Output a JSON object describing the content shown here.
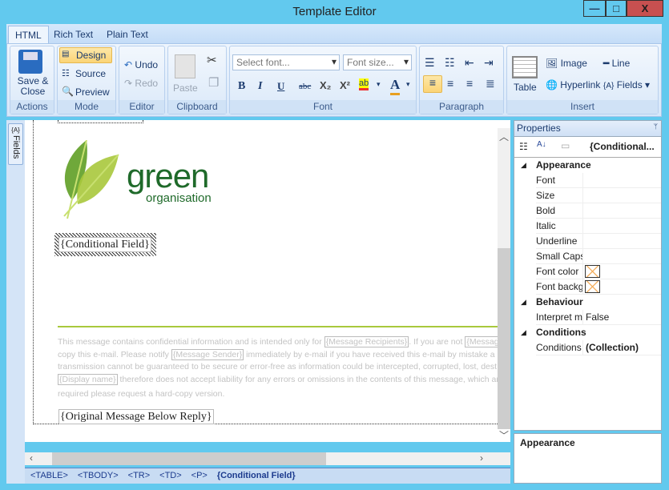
{
  "window": {
    "title": "Template Editor",
    "minimize": "—",
    "maximize": "□",
    "close": "X"
  },
  "tabs": [
    {
      "label": "HTML",
      "active": true
    },
    {
      "label": "Rich Text"
    },
    {
      "label": "Plain Text"
    }
  ],
  "ribbon": {
    "actions": {
      "label": "Actions",
      "save": "Save & Close"
    },
    "mode": {
      "label": "Mode",
      "design": "Design",
      "source": "Source",
      "preview": "Preview",
      "selected": "Design"
    },
    "editor": {
      "label": "Editor",
      "undo": "Undo",
      "redo": "Redo"
    },
    "clipboard": {
      "label": "Clipboard",
      "paste": "Paste"
    },
    "font": {
      "label": "Font",
      "font_placeholder": "Select font...",
      "size_placeholder": "Font size...",
      "bold": "B",
      "italic": "I",
      "underline": "U",
      "strike": "abc",
      "sub": "X₂",
      "sup": "X²",
      "highlight": "ab",
      "color": "A"
    },
    "paragraph": {
      "label": "Paragraph",
      "alignment": "left"
    },
    "insert": {
      "label": "Insert",
      "table": "Table",
      "image": "Image",
      "line": "Line",
      "hyperlink": "Hyperlink",
      "fields": "Fields"
    }
  },
  "side_tab": {
    "label": "Fields",
    "icon": "{A}"
  },
  "document": {
    "logo": {
      "big": "green",
      "small": "organisation"
    },
    "conditional_field": "{Conditional Field}",
    "disclaimer": [
      [
        "This message contains confidential information and is intended only for ",
        "{Message Recipients}",
        ". If you are not ",
        "{Messag"
      ],
      [
        "copy this e-mail. Please notify ",
        "{Message Sender}",
        " immediately by e-mail if you have received this e-mail by mistake a"
      ],
      [
        "transmission cannot be guaranteed to be secure or error-free as information could be intercepted, corrupted, lost, dest"
      ],
      [
        "{Display name}",
        " therefore does not accept liability for any errors or omissions in the contents of this message, which ari"
      ]
    ],
    "disclaimer_end": "required please request a hard-copy version.",
    "original_message": "{Original Message Below Reply}",
    "accent": "#a8c83c"
  },
  "breadcrumb": [
    "<TABLE>",
    "<TBODY>",
    "<TR>",
    "<TD>",
    "<P>",
    "{Conditional Field}"
  ],
  "properties": {
    "title": "Properties",
    "pin": "📌",
    "object": "{Conditional...",
    "categories": [
      {
        "name": "Appearance",
        "rows": [
          {
            "name": "Font",
            "value": ""
          },
          {
            "name": "Size",
            "value": ""
          },
          {
            "name": "Bold",
            "value": ""
          },
          {
            "name": "Italic",
            "value": ""
          },
          {
            "name": "Underline",
            "value": ""
          },
          {
            "name": "Small Caps",
            "value": ""
          },
          {
            "name": "Font color",
            "value": "",
            "swatch": true
          },
          {
            "name": "Font backg",
            "value": "",
            "swatch": true
          }
        ]
      },
      {
        "name": "Behaviour",
        "rows": [
          {
            "name": "Interpret m",
            "value": "False"
          }
        ]
      },
      {
        "name": "Conditions",
        "rows": [
          {
            "name": "Conditions",
            "value": "(Collection)",
            "bold": true
          }
        ]
      }
    ],
    "description_title": "Appearance"
  }
}
